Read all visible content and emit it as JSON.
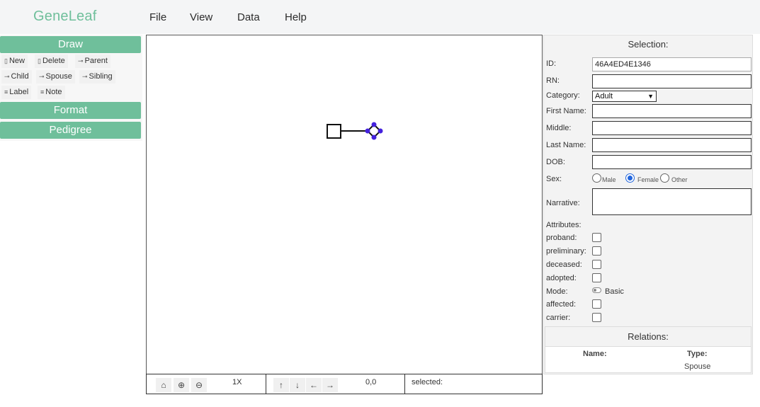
{
  "app": {
    "logo": "GeneLeaf"
  },
  "menu": {
    "items": [
      "File",
      "View",
      "Data",
      "Help"
    ]
  },
  "left_panel": {
    "draw_label": "Draw",
    "format_label": "Format",
    "pedigree_label": "Pedigree",
    "tools": {
      "new": "New",
      "delete": "Delete",
      "parent": "Parent",
      "child": "Child",
      "spouse": "Spouse",
      "sibling": "Sibling",
      "label": "Label",
      "note": "Note"
    }
  },
  "bottom_bar": {
    "zoom": "1X",
    "coords": "0,0",
    "selected": "selected:"
  },
  "selection": {
    "header": "Selection:",
    "id_label": "ID:",
    "id_value": "46A4ED4E1346",
    "rn_label": "RN:",
    "category_label": "Category:",
    "category_value": "Adult",
    "first_name_label": "First Name:",
    "middle_label": "Middle:",
    "last_name_label": "Last Name:",
    "dob_label": "DOB:",
    "sex_label": "Sex:",
    "sex_options": {
      "male": "Male",
      "female": "Female",
      "other": "Other"
    },
    "sex_selected": "Female",
    "narrative_label": "Narrative:",
    "attributes_label": "Attributes:",
    "proband_label": "proband:",
    "preliminary_label": "preliminary:",
    "deceased_label": "deceased:",
    "adopted_label": "adopted:",
    "mode_label": "Mode:",
    "mode_value": "Basic",
    "affected_label": "affected:",
    "carrier_label": "carrier:"
  },
  "relations": {
    "title": "Relations:",
    "name_header": "Name:",
    "type_header": "Type:",
    "rows": [
      {
        "name": "",
        "type": "Spouse"
      }
    ]
  },
  "colors": {
    "accent": "#6fbf9b",
    "selection_handle": "#3322cc"
  }
}
